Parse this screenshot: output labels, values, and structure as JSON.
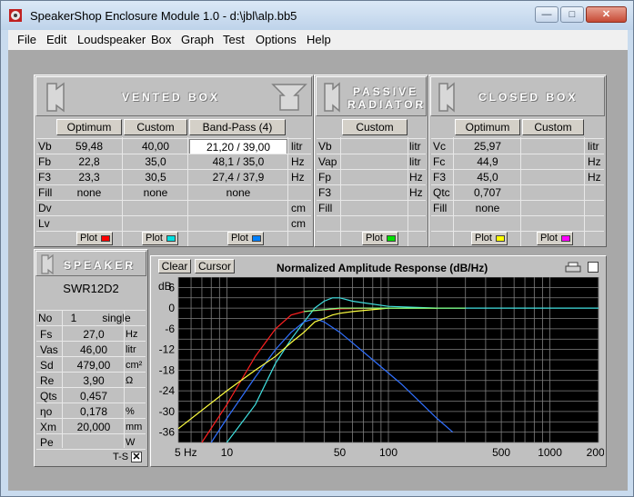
{
  "window": {
    "title": "SpeakerShop Enclosure Module 1.0 - d:\\jbl\\alp.bb5",
    "minimize": "—",
    "maximize": "□",
    "close": "✕"
  },
  "menu": [
    "File",
    "Edit",
    "Loudspeaker",
    "Box",
    "Graph",
    "Test",
    "Options",
    "Help"
  ],
  "vented": {
    "header": "VENTED BOX",
    "buttons": [
      "Optimum",
      "Custom",
      "Band-Pass (4)"
    ],
    "rows": [
      {
        "label": "Vb",
        "v1": "59,48",
        "v2": "40,00",
        "v3": "21,20 / 39,00",
        "unit": "litr"
      },
      {
        "label": "Fb",
        "v1": "22,8",
        "v2": "35,0",
        "v3": "48,1 / 35,0",
        "unit": "Hz"
      },
      {
        "label": "F3",
        "v1": "23,3",
        "v2": "30,5",
        "v3": "27,4 / 37,9",
        "unit": "Hz"
      },
      {
        "label": "Fill",
        "v1": "none",
        "v2": "none",
        "v3": "none",
        "unit": ""
      },
      {
        "label": "Dv",
        "v1": "",
        "v2": "",
        "v3": "",
        "unit": "cm"
      },
      {
        "label": "Lv",
        "v1": "",
        "v2": "",
        "v3": "",
        "unit": "cm"
      }
    ],
    "plot_labels": [
      "Plot",
      "Plot",
      "Plot"
    ],
    "plot_colors": [
      "#ff0000",
      "#00e0e0",
      "#0080ff"
    ]
  },
  "passive": {
    "header_line1": "PASSIVE",
    "header_line2": "RADIATOR",
    "button": "Custom",
    "rows": [
      {
        "label": "Vb",
        "unit": "litr"
      },
      {
        "label": "Vap",
        "unit": "litr"
      },
      {
        "label": "Fp",
        "unit": "Hz"
      },
      {
        "label": "F3",
        "unit": "Hz"
      },
      {
        "label": "Fill",
        "unit": ""
      }
    ],
    "plot_label": "Plot",
    "plot_color": "#00e000"
  },
  "closed": {
    "header": "CLOSED BOX",
    "buttons": [
      "Optimum",
      "Custom"
    ],
    "rows": [
      {
        "label": "Vc",
        "v1": "25,97",
        "unit": "litr"
      },
      {
        "label": "Fc",
        "v1": "44,9",
        "unit": "Hz"
      },
      {
        "label": "F3",
        "v1": "45,0",
        "unit": "Hz"
      },
      {
        "label": "Qtc",
        "v1": "0,707",
        "unit": ""
      },
      {
        "label": "Fill",
        "v1": "none",
        "unit": ""
      }
    ],
    "plot_labels": [
      "Plot",
      "Plot"
    ],
    "plot_colors": [
      "#ffff00",
      "#ff00ff"
    ]
  },
  "speaker": {
    "header": "SPEAKER",
    "model": "SWR12D2",
    "no_label": "No",
    "no_value": "1",
    "coil": "single",
    "rows": [
      {
        "label": "Fs",
        "value": "27,0",
        "unit": "Hz"
      },
      {
        "label": "Vas",
        "value": "46,00",
        "unit": "litr"
      },
      {
        "label": "Sd",
        "value": "479,00",
        "unit": "cm²"
      },
      {
        "label": "Re",
        "value": "3,90",
        "unit": "Ω"
      },
      {
        "label": "Qts",
        "value": "0,457",
        "unit": ""
      },
      {
        "label": "ηo",
        "value": "0,178",
        "unit": "%"
      },
      {
        "label": "Xm",
        "value": "20,000",
        "unit": "mm"
      },
      {
        "label": "Pe",
        "value": "",
        "unit": "W"
      }
    ],
    "ts_label": "T-S"
  },
  "graph": {
    "clear": "Clear",
    "cursor": "Cursor",
    "title": "Normalized Amplitude Response (dB/Hz)",
    "y_unit": "dB",
    "y_ticks": [
      "6",
      "0",
      "-6",
      "-12",
      "-18",
      "-24",
      "-30",
      "-36"
    ],
    "x_ticks": [
      "5 Hz",
      "10",
      "50",
      "100",
      "500",
      "1000",
      "2000"
    ]
  },
  "chart_data": {
    "type": "line",
    "title": "Normalized Amplitude Response (dB/Hz)",
    "xlabel": "Hz",
    "ylabel": "dB",
    "x_scale": "log",
    "xlim": [
      5,
      2000
    ],
    "ylim": [
      -39,
      9
    ],
    "grid": true,
    "series": [
      {
        "color": "#ff2020",
        "x": [
          7,
          10,
          15,
          20,
          25,
          30,
          40,
          50,
          100
        ],
        "y": [
          -39,
          -28,
          -14,
          -6,
          -2,
          -1,
          -0.5,
          -0.2,
          0
        ]
      },
      {
        "color": "#40e0e0",
        "x": [
          10,
          15,
          20,
          25,
          30,
          35,
          40,
          45,
          50,
          60,
          100,
          200,
          2000
        ],
        "y": [
          -39,
          -28,
          -16,
          -9,
          -4,
          0,
          2,
          3,
          3,
          2,
          0.5,
          0,
          0
        ]
      },
      {
        "color": "#3070ff",
        "x": [
          8,
          10,
          15,
          20,
          25,
          30,
          35,
          40,
          50,
          80,
          120,
          200,
          250
        ],
        "y": [
          -39,
          -32,
          -20,
          -12,
          -7,
          -4,
          -3,
          -4,
          -7,
          -15,
          -22,
          -32,
          -36
        ]
      },
      {
        "color": "#ffff40",
        "x": [
          5,
          10,
          15,
          20,
          25,
          30,
          35,
          40,
          45,
          50,
          60,
          100,
          200
        ],
        "y": [
          -35,
          -24,
          -18,
          -14,
          -10,
          -7,
          -4,
          -3,
          -2,
          -1.5,
          -1,
          0,
          0
        ]
      },
      {
        "color": "#80ff80",
        "x": [
          30,
          50,
          100,
          200,
          300
        ],
        "y": [
          -1,
          0,
          0,
          0,
          0
        ]
      }
    ]
  }
}
